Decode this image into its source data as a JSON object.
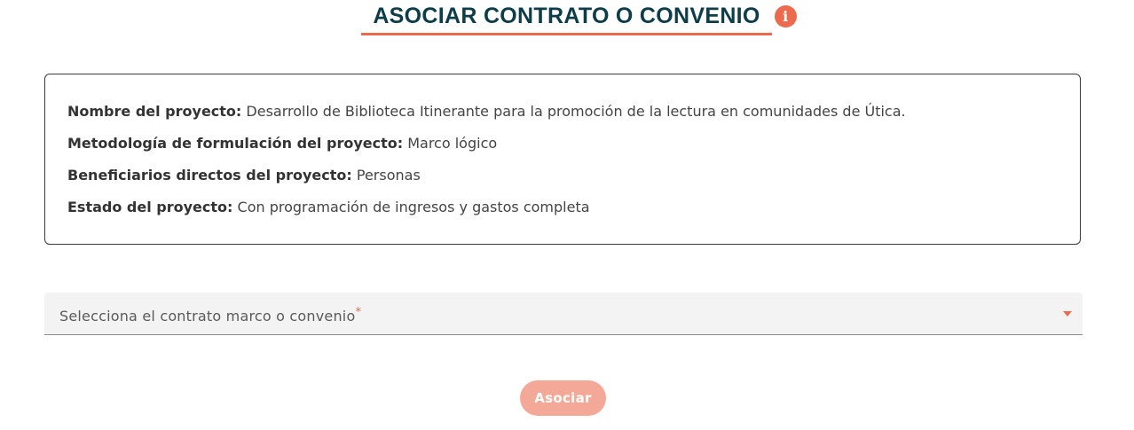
{
  "header": {
    "title": "ASOCIAR CONTRATO O CONVENIO",
    "info_icon": "info-icon",
    "info_glyph": "i"
  },
  "project": {
    "fields": [
      {
        "label": "Nombre del proyecto:",
        "value": "Desarrollo de Biblioteca Itinerante para la promoción de la lectura en comunidades de Útica."
      },
      {
        "label": "Metodología de formulación del proyecto:",
        "value": "Marco lógico"
      },
      {
        "label": "Beneficiarios directos del proyecto:",
        "value": "Personas"
      },
      {
        "label": "Estado del proyecto:",
        "value": "Con programación de ingresos y gastos completa"
      }
    ]
  },
  "form": {
    "select_label": "Selecciona el contrato marco o convenio",
    "required_mark": "*",
    "submit_label": "Asociar"
  },
  "colors": {
    "accent": "#ec6b4f",
    "title": "#0e3d4a",
    "button_disabled": "#f4a998"
  }
}
